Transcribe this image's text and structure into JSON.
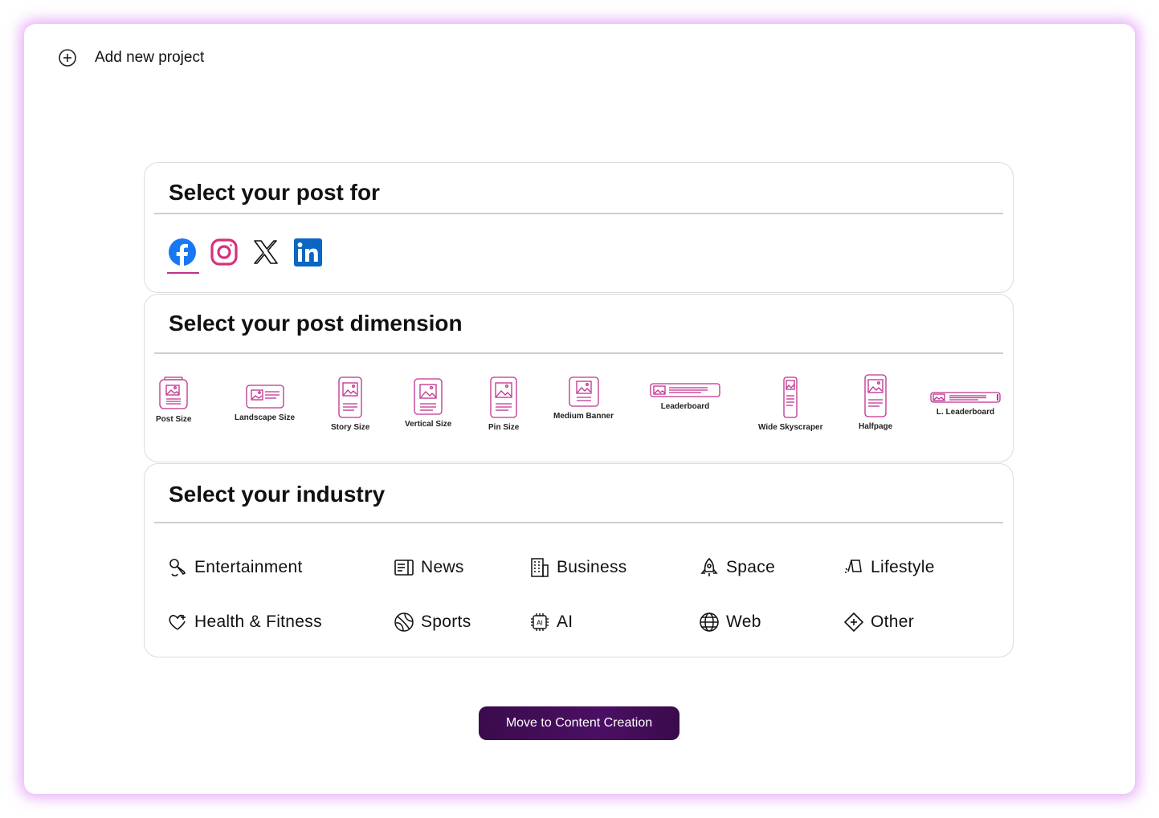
{
  "topbar": {
    "add_project_label": "Add new project"
  },
  "platform_section": {
    "title": "Select your post for",
    "selected": "facebook",
    "platforms": [
      {
        "id": "facebook",
        "icon": "facebook-icon"
      },
      {
        "id": "instagram",
        "icon": "instagram-icon"
      },
      {
        "id": "x",
        "icon": "x-icon"
      },
      {
        "id": "linkedin",
        "icon": "linkedin-icon"
      }
    ]
  },
  "dimension_section": {
    "title": "Select your post dimension",
    "dimensions": [
      {
        "label": "Post Size",
        "icon": "post-size-icon"
      },
      {
        "label": "Landscape Size",
        "icon": "landscape-size-icon"
      },
      {
        "label": "Story Size",
        "icon": "story-size-icon"
      },
      {
        "label": "Vertical Size",
        "icon": "vertical-size-icon"
      },
      {
        "label": "Pin Size",
        "icon": "pin-size-icon"
      },
      {
        "label": "Medium Banner",
        "icon": "medium-banner-icon"
      },
      {
        "label": "Leaderboard",
        "icon": "leaderboard-icon"
      },
      {
        "label": "Wide Skyscraper",
        "icon": "wide-skyscraper-icon"
      },
      {
        "label": "Halfpage",
        "icon": "halfpage-icon"
      },
      {
        "label": "L. Leaderboard",
        "icon": "large-leaderboard-icon"
      }
    ]
  },
  "industry_section": {
    "title": "Select your industry",
    "industries": [
      {
        "label": "Entertainment",
        "icon": "microphone-icon"
      },
      {
        "label": "News",
        "icon": "newspaper-icon"
      },
      {
        "label": "Business",
        "icon": "building-icon"
      },
      {
        "label": "Space",
        "icon": "rocket-icon"
      },
      {
        "label": "Lifestyle",
        "icon": "lifestyle-icon"
      },
      {
        "label": "Health & Fitness",
        "icon": "heart-plus-icon"
      },
      {
        "label": "Sports",
        "icon": "ball-icon"
      },
      {
        "label": "AI",
        "icon": "ai-chip-icon"
      },
      {
        "label": "Web",
        "icon": "globe-icon"
      },
      {
        "label": "Other",
        "icon": "diamond-plus-icon"
      }
    ]
  },
  "cta": {
    "label": "Move to Content Creation"
  },
  "colors": {
    "accent": "#c0308f",
    "button": "#3a0b4c",
    "glow": "#d678f0"
  }
}
